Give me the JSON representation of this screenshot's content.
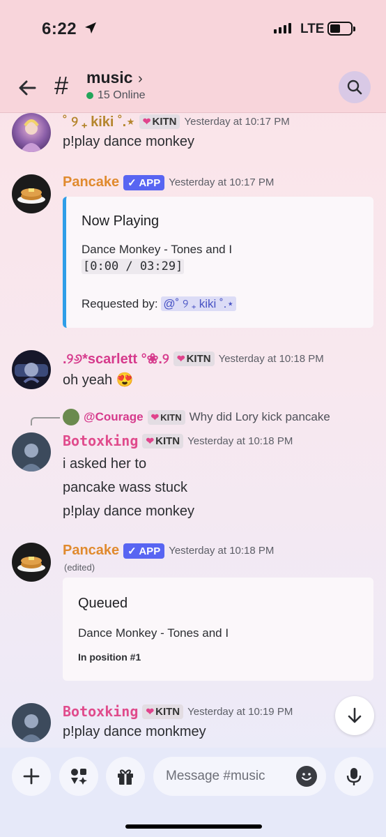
{
  "status_bar": {
    "time": "6:22",
    "network": "LTE"
  },
  "header": {
    "channel_hash": "#",
    "channel_name": "music",
    "chevron": "›",
    "online": "15 Online"
  },
  "messages": [
    {
      "name": "˚ ୨ ₊ kiki ˚.⋆",
      "tag": "KITN",
      "timestamp": "Yesterday at 10:17 PM",
      "text": "p!play dance monkey",
      "name_color": "#b5862e"
    },
    {
      "name": "Pancake",
      "app_tag": "✓ APP",
      "timestamp": "Yesterday at 10:17 PM",
      "name_color": "#e08a2e",
      "embed": {
        "title": "Now Playing",
        "song": "Dance Monkey - Tones and I",
        "progress": "[0:00 / 03:29]",
        "requested_label": "Requested by:",
        "requested_user": "@˚ ୨ ₊ kiki ˚.⋆"
      }
    },
    {
      "name": ".୨୬*scarlett °❀.୨",
      "tag": "KITN",
      "timestamp": "Yesterday at 10:18 PM",
      "text": "oh yeah 😍",
      "name_color": "#d63a8c"
    },
    {
      "reply": {
        "user": "@Courage",
        "tag": "KITN",
        "text": "Why did Lory kick pancake"
      },
      "name": "Botoxking",
      "tag": "KITN",
      "timestamp": "Yesterday at 10:18 PM",
      "lines": [
        "i asked her to",
        "pancake wass stuck",
        "p!play dance monkey"
      ],
      "name_color": "#e04b8c"
    },
    {
      "name": "Pancake",
      "app_tag": "✓ APP",
      "timestamp": "Yesterday at 10:18 PM",
      "edited": "(edited)",
      "name_color": "#e08a2e",
      "embed": {
        "title": "Queued",
        "song": "Dance Monkey - Tones and I",
        "position": "In position #1"
      }
    },
    {
      "name": "Botoxking",
      "tag": "KITN",
      "timestamp": "Yesterday at 10:19 PM",
      "text": "p!play dance monkmey",
      "name_color": "#e04b8c"
    }
  ],
  "composer": {
    "placeholder": "Message #music"
  },
  "icons": {
    "back": "back-arrow-icon",
    "search": "search-icon",
    "plus": "plus-icon",
    "apps": "apps-icon",
    "gift": "gift-icon",
    "emoji": "emoji-icon",
    "mic": "mic-icon",
    "scroll": "scroll-down-icon"
  },
  "colors": {
    "header_bg": "#f8d5db",
    "app_badge": "#5865f2",
    "online_dot": "#23a55a",
    "embed_bar": "#2f9ee8"
  }
}
